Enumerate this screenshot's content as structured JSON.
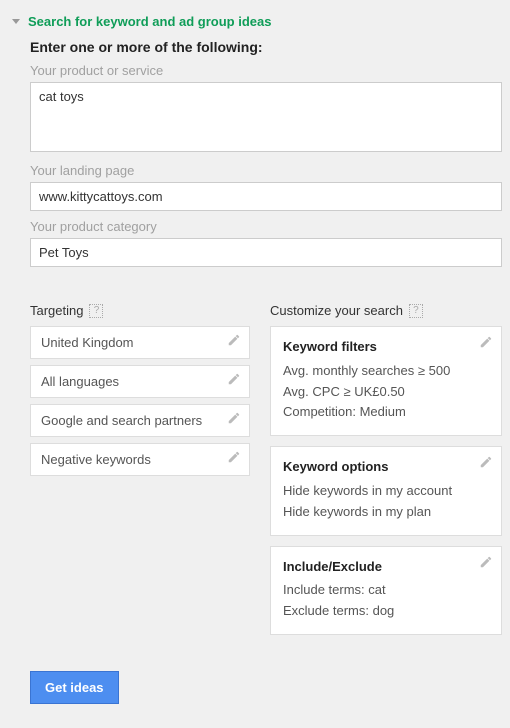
{
  "header": "Search for keyword and ad group ideas",
  "subheader": "Enter one or more of the following:",
  "fields": {
    "product_label": "Your product or service",
    "product_value": "cat toys",
    "landing_label": "Your landing page",
    "landing_value": "www.kittycattoys.com",
    "category_label": "Your product category",
    "category_value": "Pet Toys"
  },
  "targeting": {
    "title": "Targeting",
    "items": [
      "United Kingdom",
      "All languages",
      "Google and search partners",
      "Negative keywords"
    ]
  },
  "customize": {
    "title": "Customize your search",
    "filters": {
      "title": "Keyword filters",
      "lines": [
        "Avg. monthly searches ≥ 500",
        "Avg. CPC ≥ UK£0.50",
        "Competition: Medium"
      ]
    },
    "options": {
      "title": "Keyword options",
      "lines": [
        "Hide keywords in my account",
        "Hide keywords in my plan"
      ]
    },
    "include": {
      "title": "Include/Exclude",
      "lines": [
        "Include terms: cat",
        "Exclude terms: dog"
      ]
    }
  },
  "button": "Get ideas",
  "help": "?"
}
